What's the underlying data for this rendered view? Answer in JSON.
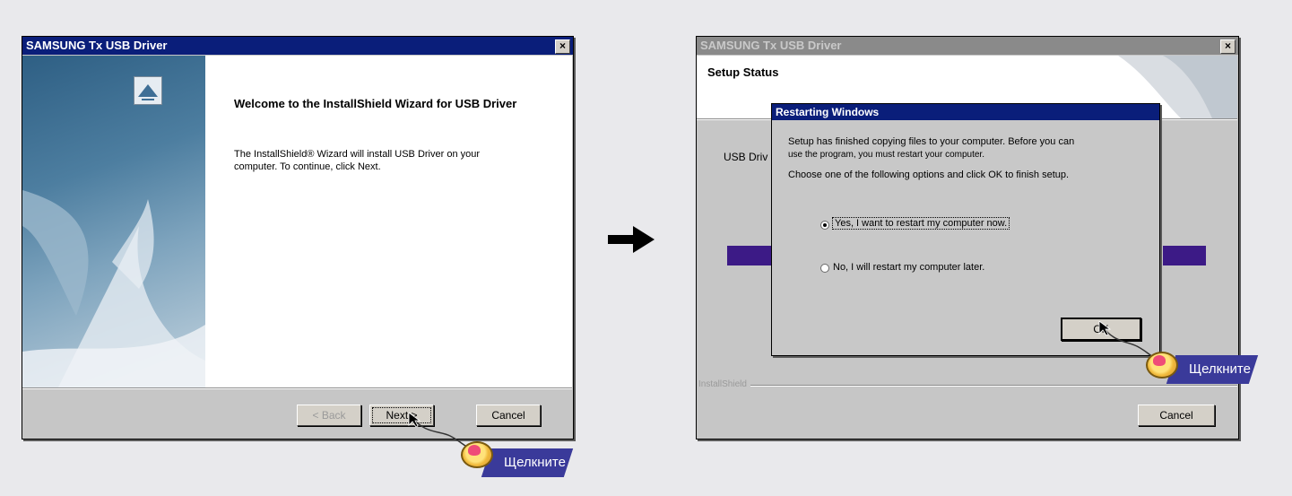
{
  "left_window": {
    "title": "SAMSUNG Tx USB Driver",
    "close_glyph": "×",
    "heading": "Welcome to the InstallShield Wizard for USB Driver",
    "body": "The InstallShield® Wizard will install USB Driver on your computer.  To continue, click Next.",
    "buttons": {
      "back": "< Back",
      "next": "Next >",
      "cancel": "Cancel"
    }
  },
  "arrow_glyph": "➔",
  "right_window": {
    "title": "SAMSUNG Tx USB Driver",
    "close_glyph": "×",
    "header_title": "Setup Status",
    "status_text": "USB Driv",
    "footer_brand": "InstallShield",
    "buttons": {
      "cancel": "Cancel"
    }
  },
  "dialog": {
    "title": "Restarting Windows",
    "line1": "Setup has finished copying files to your computer.  Before you can",
    "line2": "use the program, you must restart your computer.",
    "line3": "Choose one of the following options and click OK to finish setup.",
    "option_yes": "Yes, I want to restart my computer now.",
    "option_no": "No, I will restart my computer later.",
    "ok": "OK"
  },
  "callouts": {
    "left": "Щелкните",
    "right": "Щелкните"
  },
  "colors": {
    "titlebar": "#0a1e7a",
    "progress": "#3c1a86",
    "callout": "#3a3a9a"
  }
}
